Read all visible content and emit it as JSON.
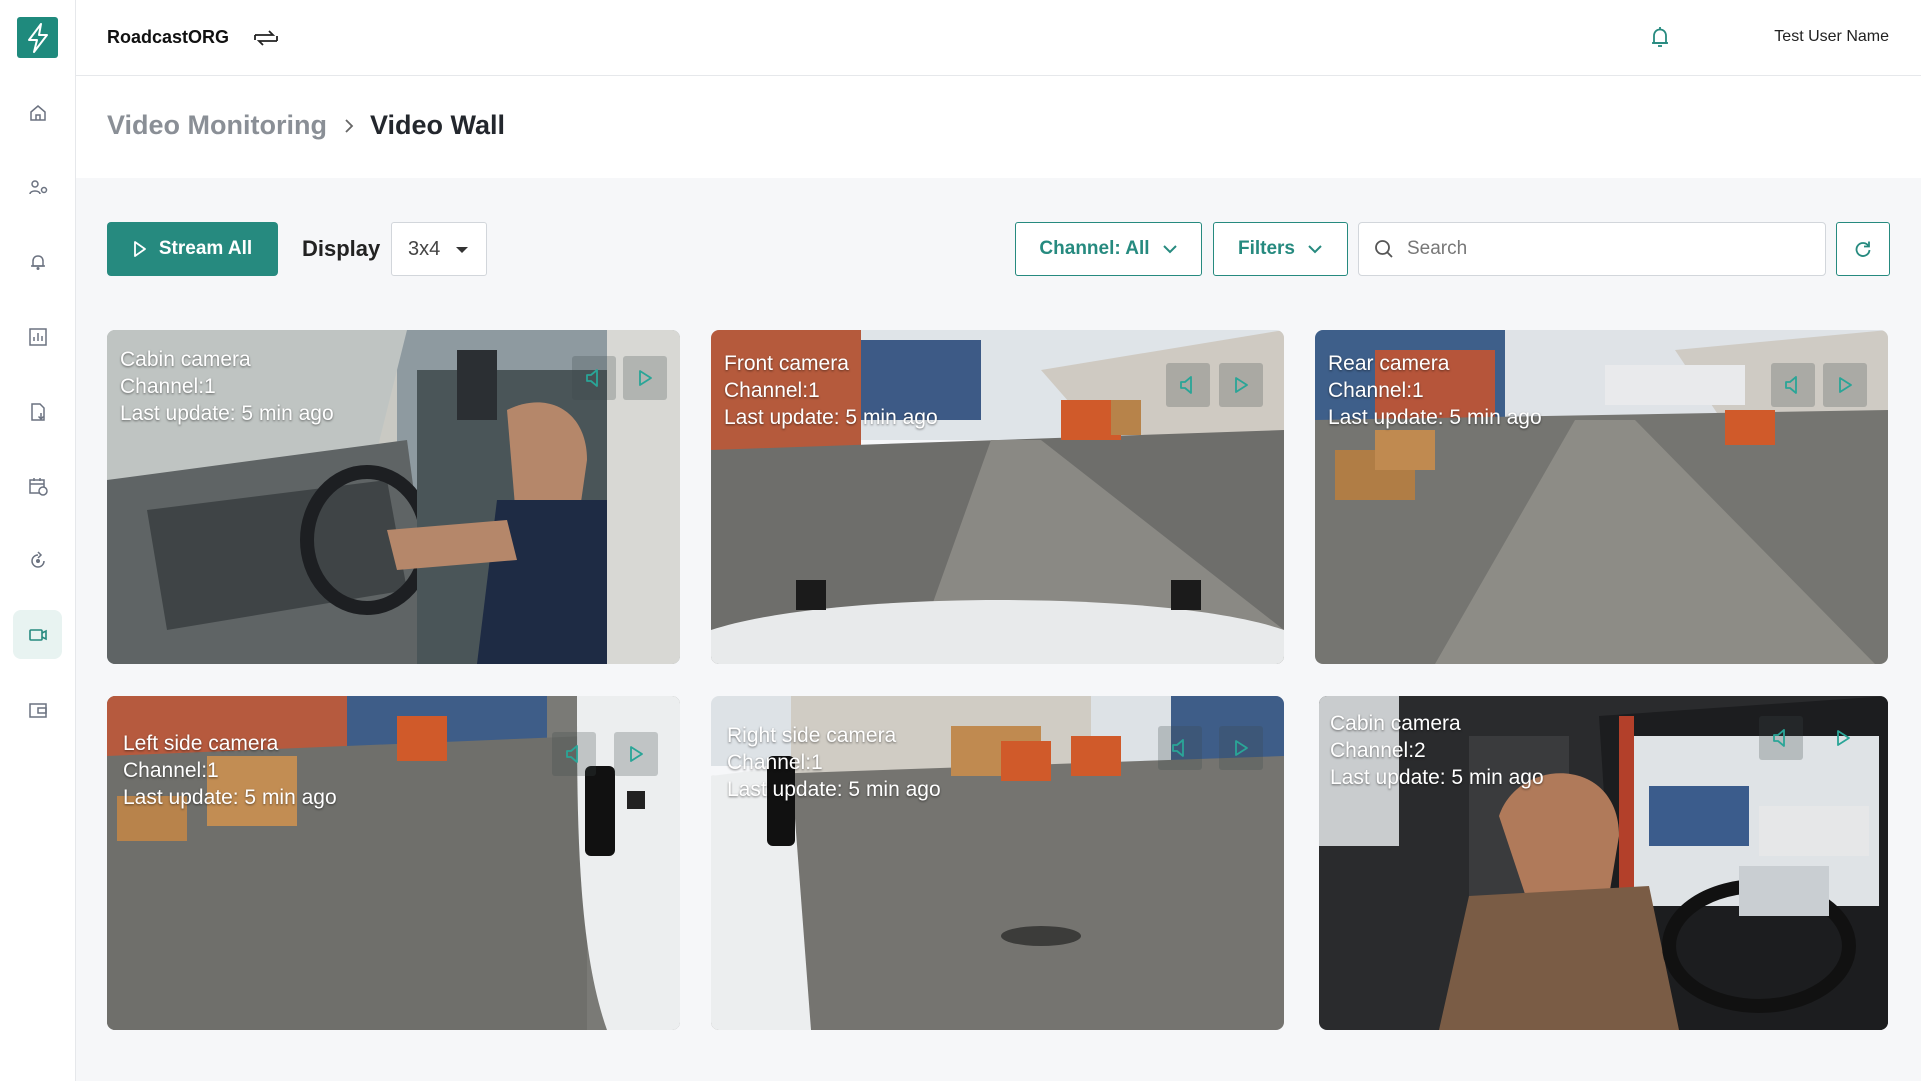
{
  "app": {
    "org_name": "RoadcastORG",
    "user_name": "Test User Name"
  },
  "breadcrumb": {
    "parent": "Video Monitoring",
    "current": "Video Wall"
  },
  "toolbar": {
    "stream_all_label": "Stream All",
    "display_label": "Display",
    "display_value": "3x4",
    "channel_label": "Channel: All",
    "filters_label": "Filters",
    "search_placeholder": "Search"
  },
  "sidebar": {
    "items": [
      {
        "icon": "home-icon"
      },
      {
        "icon": "users-settings-icon"
      },
      {
        "icon": "alert-bell-icon"
      },
      {
        "icon": "bar-chart-icon"
      },
      {
        "icon": "document-download-icon"
      },
      {
        "icon": "calendar-clock-icon"
      },
      {
        "icon": "route-refresh-icon"
      },
      {
        "icon": "video-camera-icon",
        "active": true
      },
      {
        "icon": "wallet-icon"
      }
    ]
  },
  "colors": {
    "accent": "#268a7f",
    "active_nav_bg": "#e8f3f1",
    "content_bg": "#f6f7f9"
  },
  "cameras": [
    {
      "name": "Cabin camera",
      "channel": "Channel:1",
      "updated": "Last update: 5 min ago"
    },
    {
      "name": "Front camera",
      "channel": "Channel:1",
      "updated": "Last update: 5 min ago"
    },
    {
      "name": "Rear camera",
      "channel": "Channel:1",
      "updated": "Last update: 5 min ago"
    },
    {
      "name": "Left side camera",
      "channel": "Channel:1",
      "updated": "Last update: 5 min ago"
    },
    {
      "name": "Right side camera",
      "channel": "Channel:1",
      "updated": "Last update: 5 min ago"
    },
    {
      "name": "Cabin camera",
      "channel": "Channel:2",
      "updated": "Last update: 5 min ago"
    }
  ]
}
